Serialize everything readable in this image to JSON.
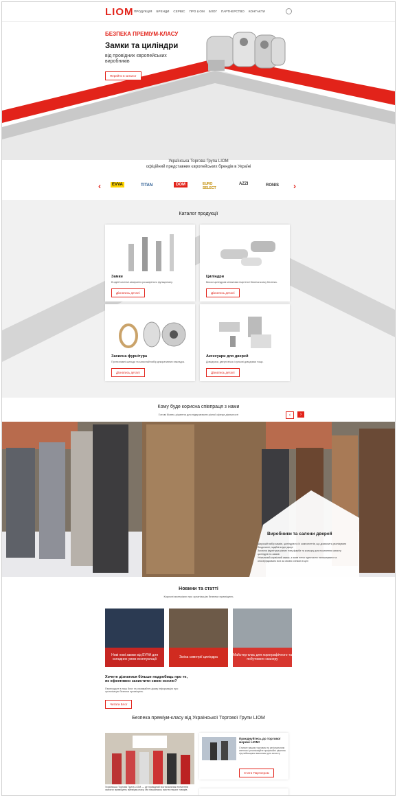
{
  "header": {
    "logo": "LIOM",
    "nav": [
      "ПРОДУКЦІЯ",
      "БРЕНДИ",
      "СЕРВІС",
      "ПРО LIOM",
      "БЛОГ",
      "ПАРТНЕРСТВО",
      "КОНТАКТИ"
    ]
  },
  "hero": {
    "kicker": "БЕЗПЕКА ПРЕМІУМ-КЛАСУ",
    "title": "Замки та циліндри",
    "subtitle": "від провідних європейських виробників",
    "button": "Перейти в каталог"
  },
  "brands": {
    "line1": "Українська Торгова Група LIOM",
    "line2": "офіційний представник європейських брендів в Україні",
    "items": [
      "EVVA",
      "TITAN",
      "DOM",
      "EURO SELECT",
      "AZZI",
      "RONIS"
    ]
  },
  "catalog": {
    "title": "Каталог продукції",
    "cards": [
      {
        "title": "Замки",
        "desc": "В одній системі запирання розширеного функціоналу.",
        "button": "Дізнатись деталі"
      },
      {
        "title": "Циліндри",
        "desc": "Високі циліндрові механізми іпартеної безпеки класу Безпека.",
        "button": "Дізнатись деталі"
      },
      {
        "title": "Захисна фурнітура",
        "desc": "Протизламні шильди та захисний вибір декоративних накладок.",
        "button": "Дізнатись деталі"
      },
      {
        "title": "Аксесуари для дверей",
        "desc": "Доводчики, дверні вічка і кульові доводчики тощо.",
        "button": "Дізнатись деталі"
      }
    ]
  },
  "coop": {
    "title": "Кому буде корисна співпраця з нами",
    "subtitle": "Готові бізнес-рішення для підприємств різної сфери діяльності",
    "panel_title": "Виробники та салони дверей",
    "points": [
      "Широкий вибір замків, циліндрів та їх компонентів, що дозволить реалізувати бездоганні, надійні вхідні двері",
      "Захисна фурнітура різних типу фарби та кольору для посилення захисту циліндрів та замків",
      "Унікальний сервісний замок, з яким легко одночасно налаштувати та опосередковано всіх за своєю схемою в цілі"
    ]
  },
  "news": {
    "title": "Новини та статті",
    "subtitle": "Корисні матеріали про організацію безпеки приміщень",
    "cards": [
      "Нові нові замки від EVVA для складних умов експлуатації",
      "Зміна симетрії циліндра",
      "Майстер-клас для хорографічного та побутового сканеру"
    ],
    "more_q": "Хочете дізнатися більше подробиць про те, як ефективно захистити свою оселю?",
    "more_desc": "Переходьте в наш блог та отримайте цікаву інформацію про організацію безпеки приміщень.",
    "more_btn": "Читати Блог"
  },
  "bottom": {
    "title": "Безпека преміум-класу від Української Торгової Групи LIOM",
    "team_text": "Українська Торгова Група LIOM — це провідний постачальник елементів захисту приміщень преміум-класу. Ми пишаємось якістю наших товарів.",
    "partner_title": "Приєднуйтесь до торгової мережі LIOM!",
    "partner_desc": "Станьте нашим торговим та регіональним агентом і реалізовуйте професійні рішення під найвищими вимогами для захисту.",
    "partner_btn": "Стати Партнером"
  }
}
